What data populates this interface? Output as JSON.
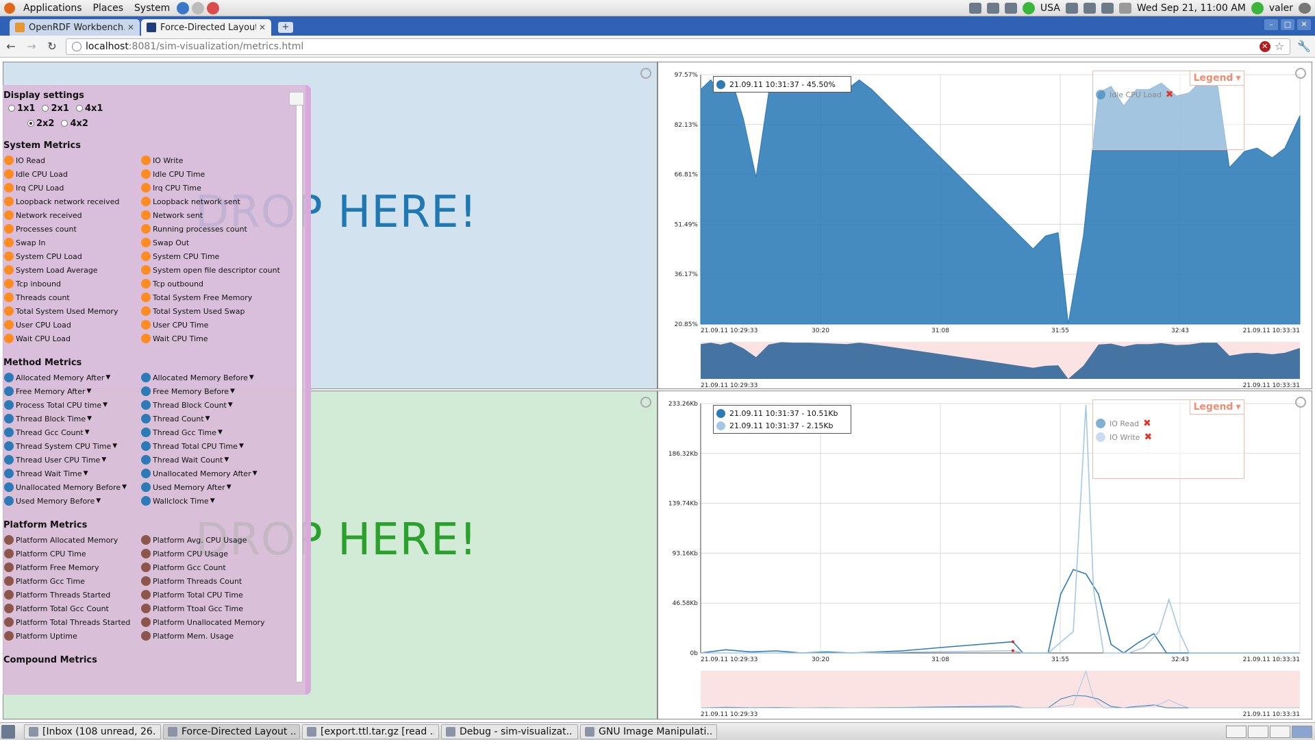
{
  "panel": {
    "menus": [
      "Applications",
      "Places",
      "System"
    ],
    "locale": "USA",
    "datetime": "Wed Sep 21, 11:00 AM",
    "user": "valer"
  },
  "browser": {
    "tabs": [
      {
        "title": "OpenRDF Workbench...",
        "active": false
      },
      {
        "title": "Force-Directed Layout",
        "active": true
      }
    ],
    "url_host": "localhost",
    "url_path": ":8081/sim-visualization/metrics.html"
  },
  "drop_zones": {
    "top_left": "DROP HERE!",
    "bottom_left": "DROP HERE!"
  },
  "palette": {
    "display_settings": {
      "title": "Display settings",
      "options": [
        "1x1",
        "2x1",
        "4x1",
        "2x2",
        "4x2"
      ],
      "selected": "2x2"
    },
    "sections": [
      {
        "title": "System Metrics",
        "color": "#ff8c22",
        "items": [
          "IO Read",
          "IO Write",
          "Idle CPU Load",
          "Idle CPU Time",
          "Irq CPU Load",
          "Irq CPU Time",
          "Loopback network received",
          "Loopback network sent",
          "Network received",
          "Network sent",
          "Processes count",
          "Running processes count",
          "Swap In",
          "Swap Out",
          "System CPU Load",
          "System CPU Time",
          "System Load Average",
          "System open file descriptor count",
          "Tcp inbound",
          "Tcp outbound",
          "Threads count",
          "Total System Free Memory",
          "Total System Used Memory",
          "Total System Used Swap",
          "User CPU Load",
          "User CPU Time",
          "Wait CPU Load",
          "Wait CPU Time"
        ]
      },
      {
        "title": "Method Metrics",
        "color": "#2c7bb6",
        "items": [
          "Allocated Memory After",
          "Allocated Memory Before",
          "Free Memory After",
          "Free Memory Before",
          "Process Total CPU time",
          "Thread Block Count",
          "Thread Block Time",
          "Thread Count",
          "Thread Gcc Count",
          "Thread Gcc Time",
          "Thread System CPU Time",
          "Thread Total CPU Time",
          "Thread User CPU Time",
          "Thread Wait Count",
          "Thread Wait Time",
          "Unallocated Memory After",
          "Unallocated Memory Before",
          "Used Memory After",
          "Used Memory Before",
          "Wallclock Time"
        ]
      },
      {
        "title": "Platform Metrics",
        "color": "#8c564b",
        "items": [
          "Platform Allocated Memory",
          "Platform Avg. CPU Usage",
          "Platform CPU Time",
          "Platform CPU Usage",
          "Platform Free Memory",
          "Platform Gcc Count",
          "Platform Gcc Time",
          "Platform Threads Count",
          "Platform Threads Started",
          "Platform Total CPU Time",
          "Platform Total Gcc Count",
          "Platform Ttoal Gcc Time",
          "Platform Total Threads Started",
          "Platform Unallocated Memory",
          "Platform Uptime",
          "Platform Mem. Usage"
        ]
      },
      {
        "title": "Compound Metrics",
        "color": "#888888",
        "items": []
      }
    ]
  },
  "chart_data": [
    {
      "type": "area",
      "title": "",
      "x_tick_labels": [
        "21.09.11 10:29:33",
        "30:20",
        "31:08",
        "31:55",
        "32:43",
        "21.09.11 10:33:31"
      ],
      "y_tick_labels": [
        "97.57%",
        "82.13%",
        "66.81%",
        "51.49%",
        "36.17%",
        "20.85%"
      ],
      "ylim": [
        20.85,
        97.57
      ],
      "overview_range": [
        "21.09.11 10:29:33",
        "21.09.11 10:33:31"
      ],
      "series": [
        {
          "name": "Idle CPU Load",
          "color": "#2c7bb6",
          "x_sec": [
            0,
            4,
            8,
            12,
            17,
            22,
            27,
            32,
            37,
            43,
            48,
            53,
            58,
            63,
            68,
            132,
            137,
            142,
            146,
            152,
            158,
            163,
            168,
            173,
            178,
            183,
            189,
            194,
            199,
            205,
            210,
            216,
            221,
            227,
            232,
            238
          ],
          "values": [
            93,
            96,
            92,
            97,
            84,
            66,
            92,
            97,
            96,
            96,
            95,
            94,
            93,
            96,
            93,
            44,
            48,
            49,
            21,
            48,
            92,
            94,
            88,
            93,
            93,
            95,
            91,
            92,
            96,
            96,
            69,
            74,
            75,
            72,
            75,
            85
          ]
        }
      ],
      "tooltip": [
        "21.09.11 10:31:37 - 45.50%"
      ],
      "legend": {
        "label": "Legend",
        "items": [
          "Idle CPU Load"
        ]
      }
    },
    {
      "type": "line",
      "title": "",
      "x_tick_labels": [
        "21.09.11 10:29:33",
        "30:20",
        "31:08",
        "31:55",
        "32:43",
        "21.09.11 10:33:31"
      ],
      "y_tick_labels": [
        "233.26Kb",
        "186.32Kb",
        "139.74Kb",
        "93.16Kb",
        "46.58Kb",
        "0b"
      ],
      "ylim": [
        0,
        233.26
      ],
      "overview_range": [
        "21.09.11 10:29:33",
        "21.09.11 10:33:31"
      ],
      "series": [
        {
          "name": "IO Read",
          "color": "#2c7bb6",
          "x_sec": [
            0,
            10,
            20,
            30,
            40,
            50,
            60,
            80,
            100,
            124,
            128,
            138,
            143,
            148,
            153,
            158,
            163,
            168,
            174,
            180,
            185,
            190,
            200,
            210,
            238
          ],
          "values": [
            0,
            3,
            1,
            2,
            0,
            1,
            0,
            2,
            6,
            10.51,
            0,
            0,
            55,
            78,
            74,
            55,
            8,
            0,
            10,
            18,
            0,
            0,
            0,
            0,
            0
          ]
        },
        {
          "name": "IO Write",
          "color": "#a6c6e6",
          "x_sec": [
            0,
            60,
            124,
            128,
            138,
            143,
            148,
            153,
            156,
            160,
            165,
            170,
            176,
            182,
            186,
            190,
            194,
            200,
            238
          ],
          "values": [
            0,
            0,
            2.15,
            0,
            0,
            10,
            20,
            232,
            60,
            0,
            0,
            0,
            5,
            20,
            50,
            20,
            0,
            0,
            0
          ]
        }
      ],
      "tooltip": [
        "21.09.11 10:31:37 - 10.51Kb",
        "21.09.11 10:31:37 - 2.15Kb"
      ],
      "legend": {
        "label": "Legend",
        "items": [
          "IO Read",
          "IO Write"
        ]
      }
    }
  ],
  "taskbar": {
    "tasks": [
      {
        "title": "[Inbox (108 unread, 26...",
        "active": false
      },
      {
        "title": "Force-Directed Layout ...",
        "active": true
      },
      {
        "title": "[export.ttl.tar.gz [read ...",
        "active": false
      },
      {
        "title": "Debug - sim-visualizat...",
        "active": false
      },
      {
        "title": "GNU Image Manipulati...",
        "active": false
      }
    ]
  }
}
